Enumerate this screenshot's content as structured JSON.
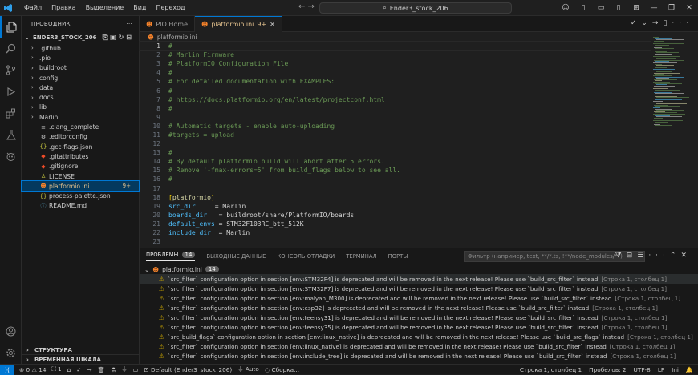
{
  "titlebar": {
    "menu": [
      "Файл",
      "Правка",
      "Выделение",
      "Вид",
      "Переход"
    ],
    "search": "Ender3_stock_206"
  },
  "sidebar": {
    "title": "ПРОВОДНИК",
    "folder": "ENDER3_STOCK_206",
    "items": [
      {
        "label": ".github",
        "folder": true
      },
      {
        "label": ".pio",
        "folder": true
      },
      {
        "label": "buildroot",
        "folder": true
      },
      {
        "label": "config",
        "folder": true
      },
      {
        "label": "data",
        "folder": true
      },
      {
        "label": "docs",
        "folder": true
      },
      {
        "label": "lib",
        "folder": true
      },
      {
        "label": "Marlin",
        "folder": true
      },
      {
        "label": ".clang_complete",
        "folder": false,
        "icon": "≡"
      },
      {
        "label": ".editorconfig",
        "folder": false,
        "icon": "⚙"
      },
      {
        "label": ".gcc-flags.json",
        "folder": false,
        "icon": "{}"
      },
      {
        "label": ".gitattributes",
        "folder": false,
        "icon": "◆"
      },
      {
        "label": ".gitignore",
        "folder": false,
        "icon": "◆"
      },
      {
        "label": "LICENSE",
        "folder": false,
        "icon": "♙"
      },
      {
        "label": "platformio.ini",
        "folder": false,
        "icon": "☻",
        "badge": "9+",
        "selected": true
      },
      {
        "label": "process-palette.json",
        "folder": false,
        "icon": "{}"
      },
      {
        "label": "README.md",
        "folder": false,
        "icon": "ⓘ"
      }
    ],
    "outline": "СТРУКТУРА",
    "timeline": "ВРЕМЕННАЯ ШКАЛА"
  },
  "tabs": [
    {
      "label": "PIO Home",
      "active": false
    },
    {
      "label": "platformio.ini",
      "badge": "9+",
      "active": true
    }
  ],
  "breadcrumb": "platformio.ini",
  "editor": {
    "lines": [
      [
        {
          "t": "#",
          "c": "c"
        }
      ],
      [
        {
          "t": "# Marlin Firmware",
          "c": "c"
        }
      ],
      [
        {
          "t": "# PlatformIO Configuration File",
          "c": "c"
        }
      ],
      [
        {
          "t": "#",
          "c": "c"
        }
      ],
      [
        {
          "t": "# For detailed documentation with EXAMPLES:",
          "c": "c"
        }
      ],
      [
        {
          "t": "#",
          "c": "c"
        }
      ],
      [
        {
          "t": "# ",
          "c": "c"
        },
        {
          "t": "https://docs.platformio.org/en/latest/projectconf.html",
          "c": "u"
        }
      ],
      [
        {
          "t": "#",
          "c": "c"
        }
      ],
      [],
      [
        {
          "t": "# Automatic targets - enable auto-uploading",
          "c": "c"
        }
      ],
      [
        {
          "t": "#targets = upload",
          "c": "c"
        }
      ],
      [],
      [
        {
          "t": "#",
          "c": "c"
        }
      ],
      [
        {
          "t": "# By default platformio build will abort after 5 errors.",
          "c": "c"
        }
      ],
      [
        {
          "t": "# Remove '-fmax-errors=5' from build_flags below to see all.",
          "c": "c"
        }
      ],
      [
        {
          "t": "#",
          "c": "c"
        }
      ],
      [],
      [
        {
          "t": "[",
          "c": "b"
        },
        {
          "t": "platformio",
          "c": "sec"
        },
        {
          "t": "]",
          "c": "b"
        }
      ],
      [
        {
          "t": "src_dir",
          "c": "k"
        },
        {
          "t": "     = Marlin",
          "c": "v"
        }
      ],
      [
        {
          "t": "boards_dir",
          "c": "k"
        },
        {
          "t": "   = buildroot/share/PlatformIO/boards",
          "c": "v"
        }
      ],
      [
        {
          "t": "default_envs",
          "c": "k"
        },
        {
          "t": " = STM32F103RC_btt_512K",
          "c": "v"
        }
      ],
      [
        {
          "t": "include_dir",
          "c": "k"
        },
        {
          "t": "  = Marlin",
          "c": "v"
        }
      ],
      [],
      [
        {
          "t": "#",
          "c": "c"
        }
      ]
    ]
  },
  "panel": {
    "tabs": [
      "ПРОБЛЕМЫ",
      "ВЫХОДНЫЕ ДАННЫЕ",
      "КОНСОЛЬ ОТЛАДКИ",
      "ТЕРМИНАЛ",
      "ПОРТЫ"
    ],
    "problem_count": "14",
    "filter_placeholder": "Фильтр (например, text, **/*.ts, !**/node_modules/**)",
    "group_file": "platformio.ini",
    "group_count": "14",
    "problems": [
      {
        "msg": "`src_filter` configuration option in section [env:STM32F4] is deprecated and will be removed in the next release! Please use `build_src_filter` instead",
        "loc": "[Строка 1, столбец 1]"
      },
      {
        "msg": "`src_filter` configuration option in section [env:STM32F7] is deprecated and will be removed in the next release! Please use `build_src_filter` instead",
        "loc": "[Строка 1, столбец 1]"
      },
      {
        "msg": "`src_filter` configuration option in section [env:malyan_M300] is deprecated and will be removed in the next release! Please use `build_src_filter` instead",
        "loc": "[Строка 1, столбец 1]"
      },
      {
        "msg": "`src_filter` configuration option in section [env:esp32] is deprecated and will be removed in the next release! Please use `build_src_filter` instead",
        "loc": "[Строка 1, столбец 1]"
      },
      {
        "msg": "`src_filter` configuration option in section [env:teensy31] is deprecated and will be removed in the next release! Please use `build_src_filter` instead",
        "loc": "[Строка 1, столбец 1]"
      },
      {
        "msg": "`src_filter` configuration option in section [env:teensy35] is deprecated and will be removed in the next release! Please use `build_src_filter` instead",
        "loc": "[Строка 1, столбец 1]"
      },
      {
        "msg": "`src_build_flags` configuration option in section [env:linux_native] is deprecated and will be removed in the next release! Please use `build_src_flags` instead",
        "loc": "[Строка 1, столбец 1]"
      },
      {
        "msg": "`src_filter` configuration option in section [env:linux_native] is deprecated and will be removed in the next release! Please use `build_src_filter` instead",
        "loc": "[Строка 1, столбец 1]"
      },
      {
        "msg": "`src_filter` configuration option in section [env:include_tree] is deprecated and will be removed in the next release! Please use `build_src_filter` instead",
        "loc": "[Строка 1, столбец 1]"
      }
    ]
  },
  "status": {
    "problems": "0 ⚠ 14",
    "ports": "1",
    "zero": "0",
    "env": "Default (Ender3_stock_206)",
    "auto": "Auto",
    "build": "Сборка...",
    "position": "Строка 1, столбец 1",
    "spaces": "Пробелов: 2",
    "encoding": "UTF-8",
    "eol": "LF",
    "lang": "Ini"
  }
}
